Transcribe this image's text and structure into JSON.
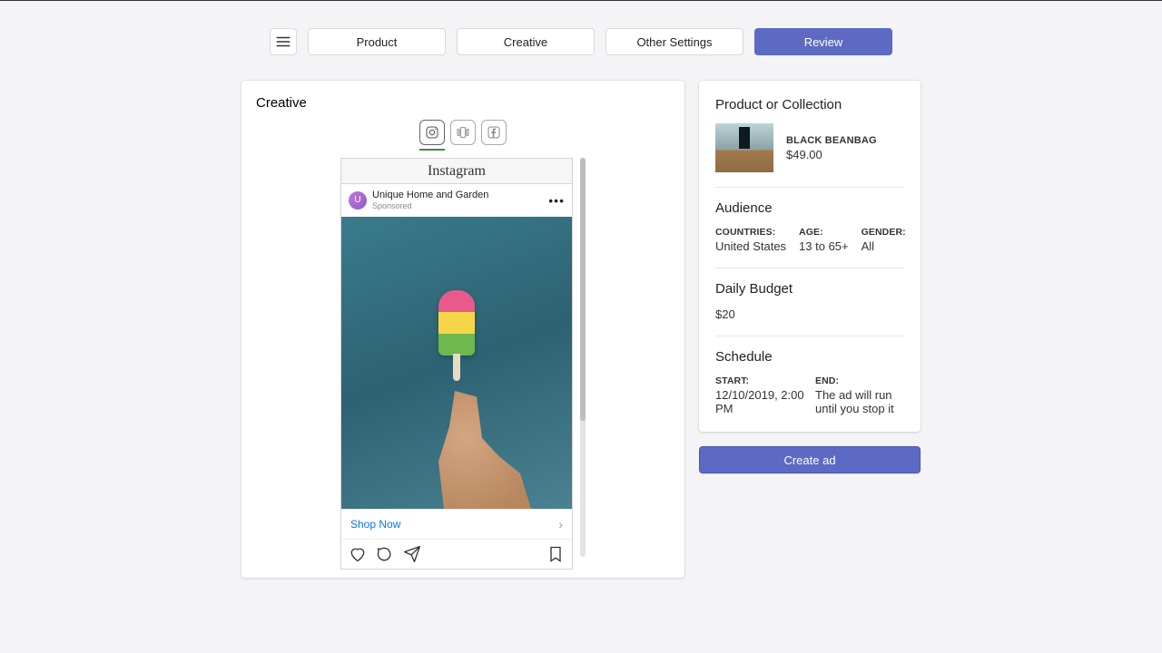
{
  "nav": {
    "tabs": [
      "Product",
      "Creative",
      "Other Settings",
      "Review"
    ],
    "active": 3
  },
  "creative": {
    "title": "Creative",
    "platforms": [
      "instagram",
      "story",
      "facebook"
    ],
    "ig": {
      "brand": "Instagram",
      "avatar_initial": "U",
      "account_name": "Unique Home and Garden",
      "sponsored": "Sponsored",
      "cta": "Shop Now"
    }
  },
  "review": {
    "product_section": "Product or Collection",
    "product": {
      "name": "BLACK BEANBAG",
      "price": "$49.00"
    },
    "audience_section": "Audience",
    "audience": {
      "countries_label": "COUNTRIES:",
      "countries": "United States",
      "age_label": "AGE:",
      "age": "13 to 65+",
      "gender_label": "GENDER:",
      "gender": "All"
    },
    "budget_section": "Daily Budget",
    "budget": "$20",
    "schedule_section": "Schedule",
    "schedule": {
      "start_label": "START:",
      "start": "12/10/2019, 2:00 PM",
      "end_label": "END:",
      "end": "The ad will run until you stop it"
    }
  },
  "actions": {
    "create": "Create ad"
  }
}
